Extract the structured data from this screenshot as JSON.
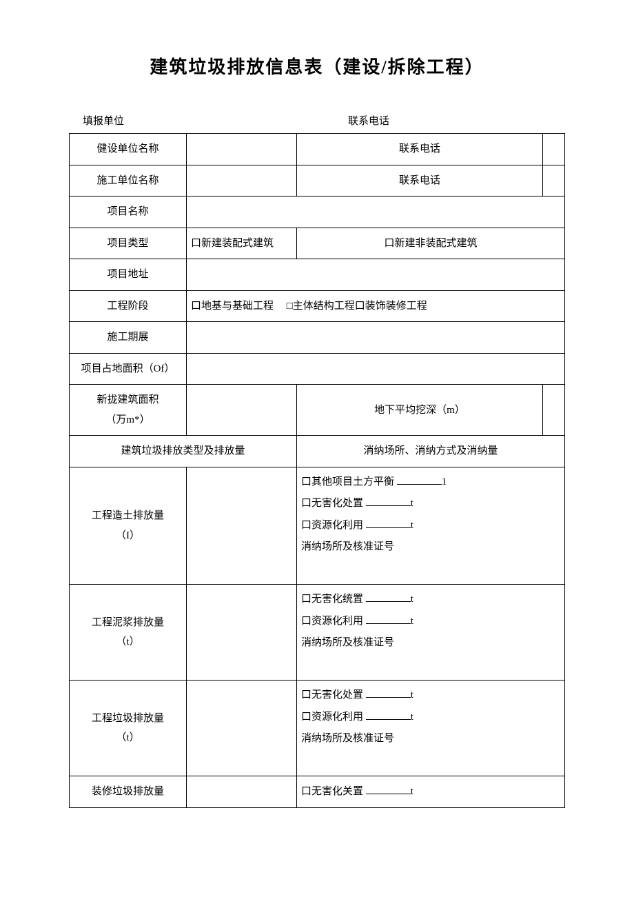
{
  "title": "建筑垃圾排放信息表（建设/拆除工程）",
  "header": {
    "reporting_unit_label": "填报单位",
    "contact_label": "联系电话"
  },
  "rows": {
    "build_unit_label": "健设单位名称",
    "build_unit_contact_label": "联系电话",
    "construction_unit_label": "施工单位名称",
    "construction_unit_contact_label": "联系电话",
    "project_name_label": "项目名称",
    "project_type_label": "项目类型",
    "project_type_opt1": "口新建装配式建筑",
    "project_type_opt2": "口新建非装配式建筑",
    "project_address_label": "项目地址",
    "project_stage_label": "工程阶段",
    "project_stage_opts": "口地基与基础工程  □主体结构工程口装饰装修工程",
    "construction_period_label": "施工期展",
    "land_area_label": "项目占地面积（Of）",
    "new_building_area_label_l1": "新拢建筑面积",
    "new_building_area_label_l2": "（万m*）",
    "avg_depth_label": "地下平均挖深（m）",
    "emission_type_header": "建筑垃圾排放类型及排放量",
    "disposal_header": "消纳场所、消纳方式及消纳量",
    "soil_emission_label_l1": "工程造土排放量",
    "soil_emission_label_l2": "（I）",
    "soil_opt1": "口其他项目土方平衡 ",
    "soil_opt1_suffix": "1",
    "soil_opt2": "口无害化处置 ",
    "soil_opt2_suffix": "t",
    "soil_opt3": "口资源化利用 ",
    "soil_opt3_suffix": "t",
    "soil_opt4": "消纳场所及核准证号",
    "mud_emission_label_l1": "工程泥浆排放量",
    "mud_emission_label_l2": "（t）",
    "mud_opt1": "口无害化统置 ",
    "mud_opt1_suffix": "t",
    "mud_opt2": "口资源化利用 ",
    "mud_opt2_suffix": "t",
    "mud_opt3": "消纳场所及核准证号",
    "waste_emission_label_l1": "工程垃圾排放量",
    "waste_emission_label_l2": "（t）",
    "waste_opt1": "口无害化处置 ",
    "waste_opt1_suffix": "t",
    "waste_opt2": "口资源化利用 ",
    "waste_opt2_suffix": "t",
    "waste_opt3": "消纳场所及核准证号",
    "decoration_emission_label": "装修垃圾排放量",
    "decoration_opt1": "口无害化关置 ",
    "decoration_opt1_suffix": "t"
  }
}
